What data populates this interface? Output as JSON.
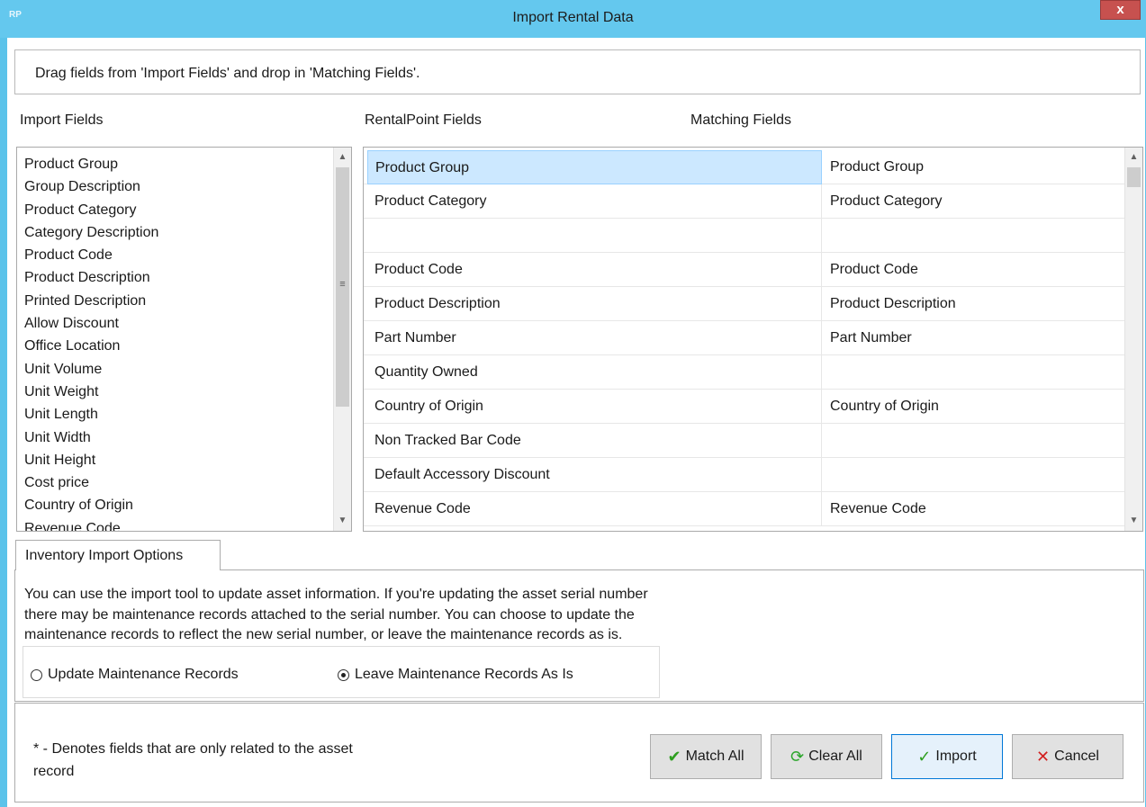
{
  "window": {
    "app_icon": "RP",
    "title": "Import Rental Data",
    "close_label": "x"
  },
  "instructions": "Drag fields from 'Import Fields' and drop in 'Matching Fields'.",
  "labels": {
    "import_fields": "Import Fields",
    "rentalpoint_fields": "RentalPoint Fields",
    "matching_fields": "Matching Fields"
  },
  "import_fields": [
    "Product Group",
    "Group Description",
    "Product Category",
    "Category Description",
    "Product Code",
    "Product Description",
    "Printed Description",
    "Allow Discount",
    "Office Location",
    "Unit Volume",
    "Unit Weight",
    "Unit Length",
    "Unit Width",
    "Unit Height",
    "Cost price",
    "Country of Origin",
    "Revenue Code"
  ],
  "mapping_rows": [
    {
      "rentalpoint": "Product Group",
      "matching": "Product Group"
    },
    {
      "rentalpoint": "Product Category",
      "matching": "Product Category"
    },
    {
      "rentalpoint": "",
      "matching": ""
    },
    {
      "rentalpoint": "Product Code",
      "matching": "Product Code"
    },
    {
      "rentalpoint": "Product Description",
      "matching": "Product Description"
    },
    {
      "rentalpoint": "Part Number",
      "matching": "Part Number"
    },
    {
      "rentalpoint": "Quantity Owned",
      "matching": ""
    },
    {
      "rentalpoint": "Country of Origin",
      "matching": "Country of Origin"
    },
    {
      "rentalpoint": "Non Tracked Bar Code",
      "matching": ""
    },
    {
      "rentalpoint": "Default Accessory Discount",
      "matching": ""
    },
    {
      "rentalpoint": "Revenue Code",
      "matching": "Revenue Code"
    }
  ],
  "options": {
    "tab_label": "Inventory Import Options",
    "text": "You can use the import tool to update asset information. If you're updating the asset serial number there may be maintenance records attached to the serial number. You can choose to update the maintenance records to reflect the new serial number, or leave the maintenance records as is.",
    "radio_update": "Update Maintenance Records",
    "radio_leave": "Leave Maintenance Records As Is",
    "selected": "leave"
  },
  "footer": {
    "note": "* - Denotes fields that are only related to the asset record",
    "match_all": "Match All",
    "clear_all": "Clear All",
    "import": "Import",
    "cancel": "Cancel"
  },
  "colors": {
    "titlebar": "#64c8ee",
    "close": "#c7514f",
    "selection": "#cce8ff"
  }
}
